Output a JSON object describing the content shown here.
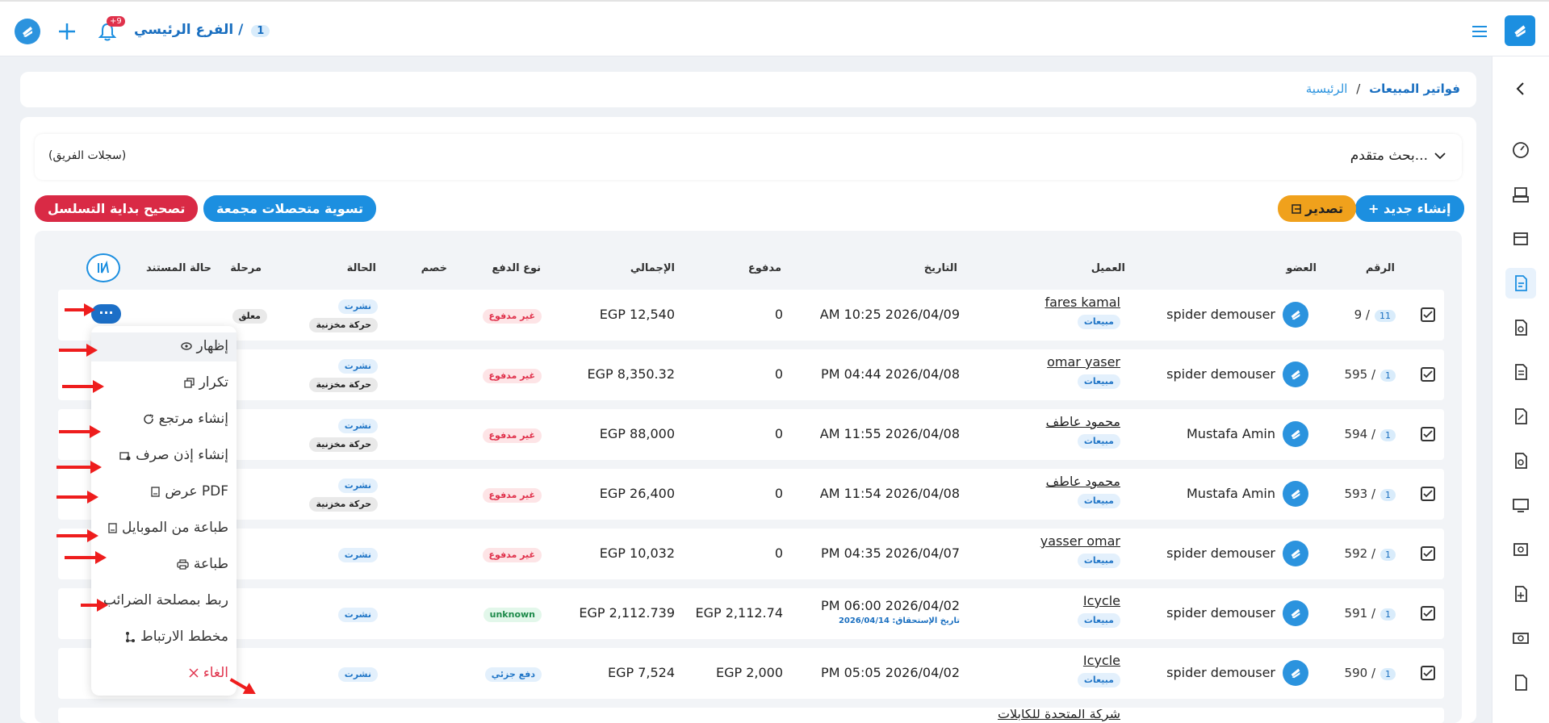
{
  "topbar": {
    "branch_num": "1",
    "branch_name": "الفرع الرئيسي /",
    "notif_count": "+9"
  },
  "breadcrumb": {
    "home": "الرئيسية",
    "sep": "/",
    "current": "فواتير المبيعات"
  },
  "search": {
    "advanced": "بحث متقدم...",
    "team_records": "(سجلات الفريق)"
  },
  "actions": {
    "create_new": "+ إنشاء جديد",
    "export": "تصدير",
    "collect_settle": "تسوية متحصلات مجمعة",
    "fix_sequence": "تصحيح بداية التسلسل"
  },
  "columns": {
    "number": "الرقم",
    "member": "العضو",
    "customer": "العميل",
    "date": "التاريخ",
    "paid": "مدفوع",
    "total": "الإجمالي",
    "payment_type": "نوع الدفع",
    "discount": "خصم",
    "status": "الحالة",
    "stage": "مرحلة",
    "doc_status": "حالة المستند"
  },
  "rows": [
    {
      "num": "9 /",
      "badge": "11",
      "member": "spider demouser",
      "customer": "fares kamal",
      "ctype": "مبيعات",
      "date": "AM 10:25 2026/04/09",
      "due": "",
      "paid": "0",
      "total": "EGP 12,540",
      "ptype": "غير مدفوع",
      "status1": "نشرت",
      "status2": "حركة مخزنية",
      "doc": "معلق"
    },
    {
      "num": "595 /",
      "badge": "1",
      "member": "spider demouser",
      "customer": "omar yaser",
      "ctype": "مبيعات",
      "date": "PM 04:44 2026/04/08",
      "due": "",
      "paid": "0",
      "total": "EGP 8,350.32",
      "ptype": "غير مدفوع",
      "status1": "نشرت",
      "status2": "حركة مخزنية",
      "doc": ""
    },
    {
      "num": "594 /",
      "badge": "1",
      "member": "Mustafa Amin",
      "customer": "محمود عاطف",
      "ctype": "مبيعات",
      "date": "AM 11:55 2026/04/08",
      "due": "",
      "paid": "0",
      "total": "EGP 88,000",
      "ptype": "غير مدفوع",
      "status1": "نشرت",
      "status2": "حركة مخزنية",
      "doc": ""
    },
    {
      "num": "593 /",
      "badge": "1",
      "member": "Mustafa Amin",
      "customer": "محمود عاطف",
      "ctype": "مبيعات",
      "date": "AM 11:54 2026/04/08",
      "due": "",
      "paid": "0",
      "total": "EGP 26,400",
      "ptype": "غير مدفوع",
      "status1": "نشرت",
      "status2": "حركة مخزنية",
      "doc": ""
    },
    {
      "num": "592 /",
      "badge": "1",
      "member": "spider demouser",
      "customer": "yasser omar",
      "ctype": "مبيعات",
      "date": "PM 04:35 2026/04/07",
      "due": "",
      "paid": "0",
      "total": "EGP 10,032",
      "ptype": "غير مدفوع",
      "status1": "نشرت",
      "status2": "",
      "doc": ""
    },
    {
      "num": "591 /",
      "badge": "1",
      "member": "spider demouser",
      "customer": "Icycle",
      "ctype": "مبيعات",
      "date": "PM 06:00 2026/04/02",
      "due": "تاريخ الإستحقاق: 2026/04/14",
      "paid": "EGP 2,112.74",
      "total": "EGP 2,112.739",
      "ptype": "unknown",
      "status1": "نشرت",
      "status2": "",
      "doc": ""
    },
    {
      "num": "590 /",
      "badge": "1",
      "member": "spider demouser",
      "customer": "Icycle",
      "ctype": "مبيعات",
      "date": "PM 05:05 2026/04/02",
      "due": "",
      "paid": "EGP 2,000",
      "total": "EGP 7,524",
      "ptype": "دفع جزئي",
      "status1": "نشرت",
      "status2": "",
      "doc": ""
    }
  ],
  "partial_row": {
    "customer": "شركة المتحدة للكابلات"
  },
  "menu": {
    "show": "إظهار",
    "duplicate": "تكرار",
    "return": "إنشاء مرتجع",
    "dispatch": "إنشاء إذن صرف",
    "pdf": "عرض PDF",
    "mobile_print": "طباعة من الموبايل",
    "print": "طباعة",
    "tax_link": "ربط بمصلحة الضرائب",
    "link_diagram": "مخطط الارتباط",
    "cancel": "الغاء"
  },
  "more_btn": "···"
}
